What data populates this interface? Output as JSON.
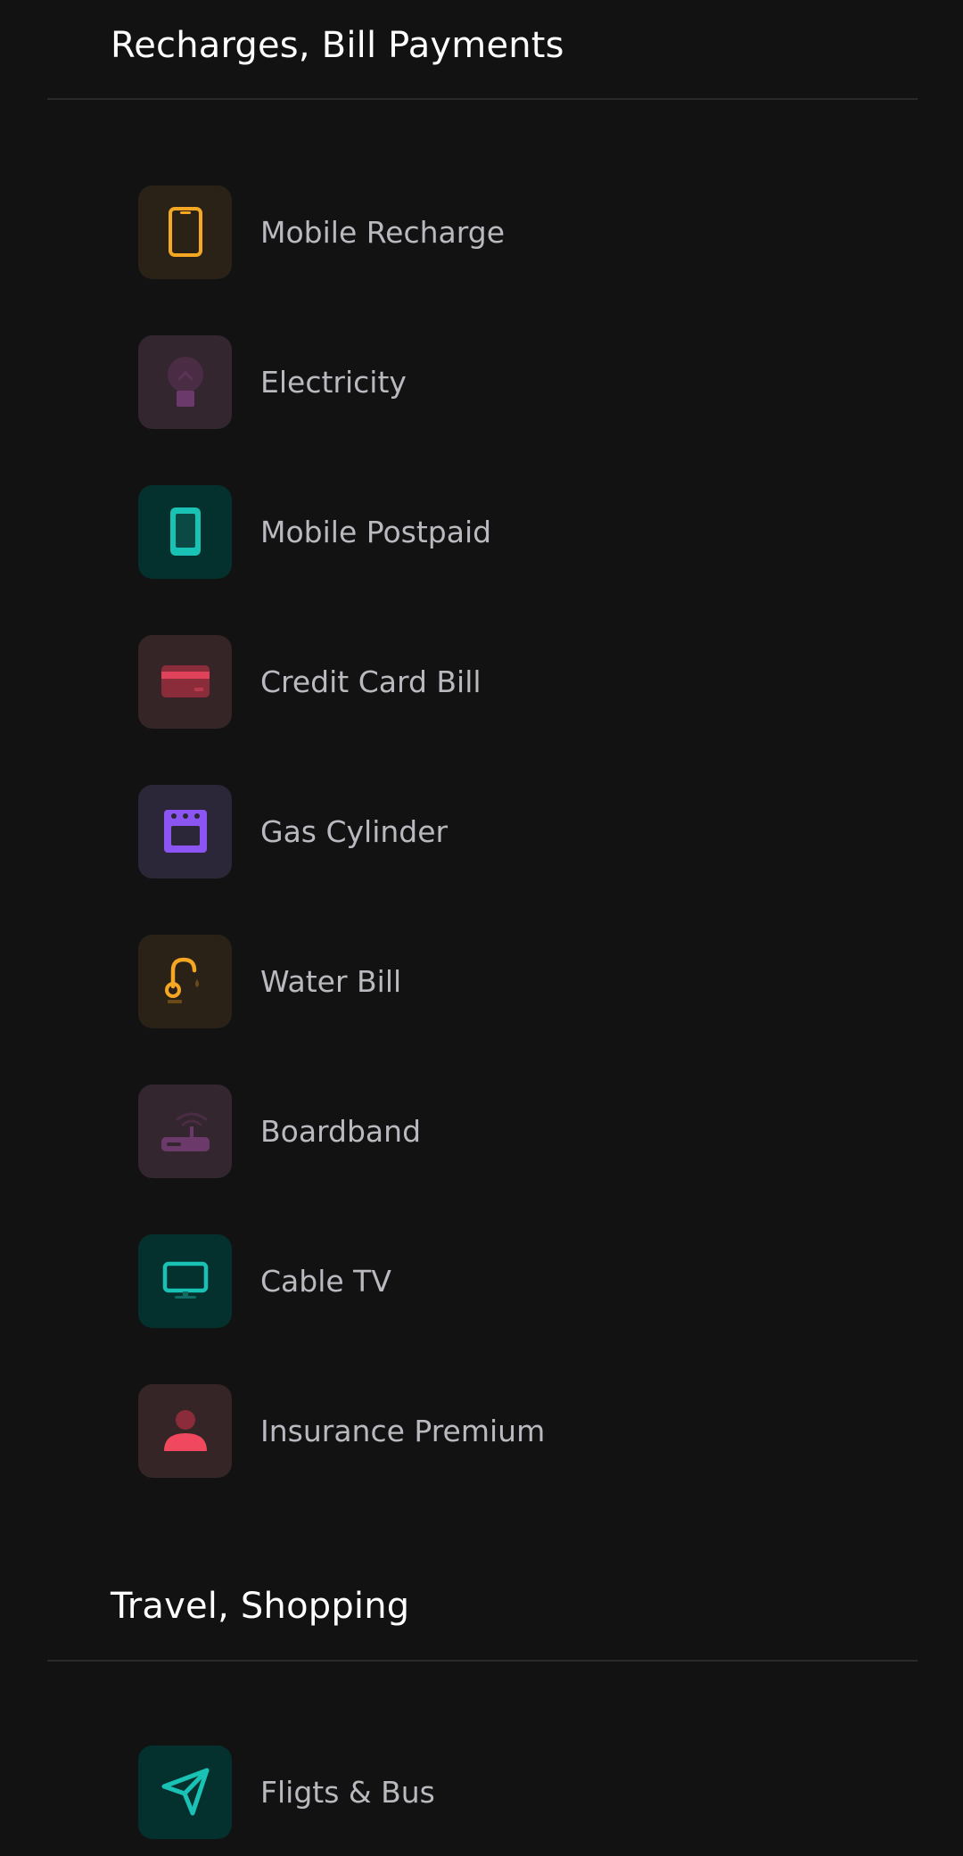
{
  "sections": [
    {
      "title": "Recharges, Bill Payments",
      "items": [
        {
          "label": "Mobile Recharge",
          "icon": "mobile-phone-icon",
          "color": "#f5a623",
          "bg": "#2a2217"
        },
        {
          "label": "Electricity",
          "icon": "lightbulb-icon",
          "color": "#6b3a6b",
          "bg": "#34262f"
        },
        {
          "label": "Mobile Postpaid",
          "icon": "smartphone-icon",
          "color": "#19c2b4",
          "bg": "#04302d"
        },
        {
          "label": "Credit Card Bill",
          "icon": "credit-card-icon",
          "color": "#e0425a",
          "bg": "#352526"
        },
        {
          "label": "Gas Cylinder",
          "icon": "oven-icon",
          "color": "#8a55f0",
          "bg": "#2c2738"
        },
        {
          "label": "Water Bill",
          "icon": "faucet-icon",
          "color": "#f5a623",
          "bg": "#2a2217"
        },
        {
          "label": "Boardband",
          "icon": "router-wifi-icon",
          "color": "#6b3a6b",
          "bg": "#34262f"
        },
        {
          "label": "Cable TV",
          "icon": "tv-monitor-icon",
          "color": "#19c2b4",
          "bg": "#04302d"
        },
        {
          "label": "Insurance Premium",
          "icon": "person-icon",
          "color": "#f0485e",
          "bg": "#352526"
        }
      ]
    },
    {
      "title": "Travel, Shopping",
      "items": [
        {
          "label": "Fligts & Bus",
          "icon": "send-paper-plane-icon",
          "color": "#19c2b4",
          "bg": "#04302d"
        }
      ]
    }
  ]
}
